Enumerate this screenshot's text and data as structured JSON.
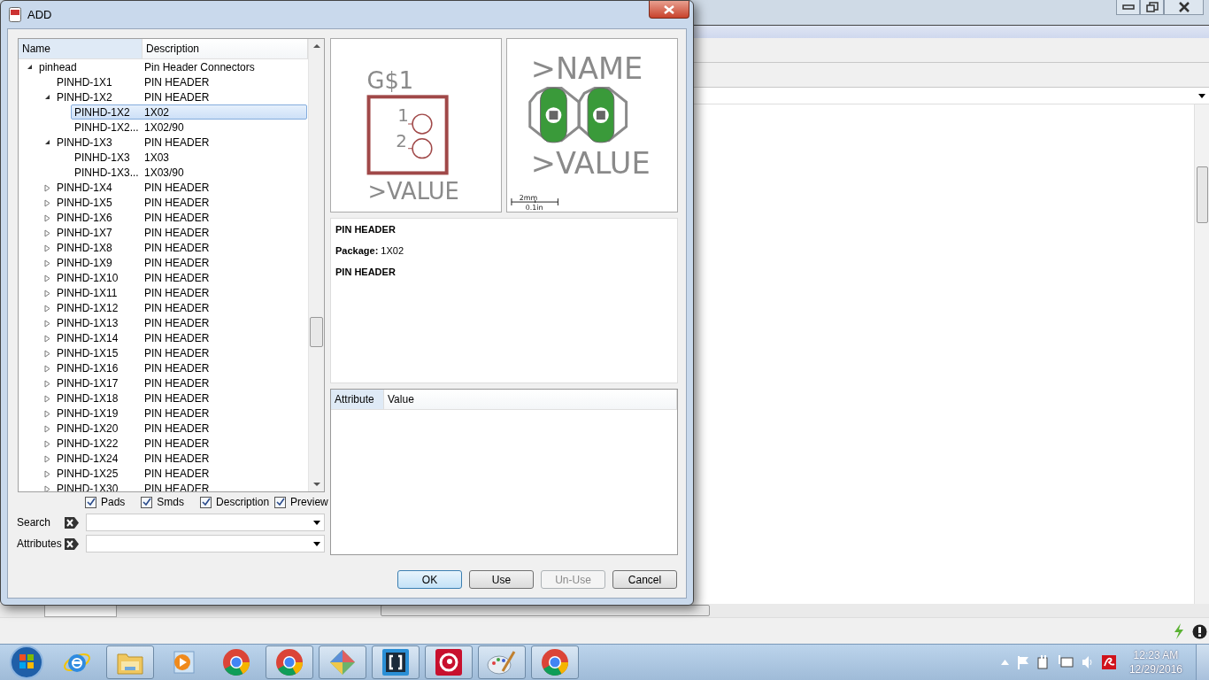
{
  "dialog": {
    "title": "ADD"
  },
  "tree": {
    "columns": [
      "Name",
      "Description"
    ],
    "items": [
      {
        "name": "pinhead",
        "description": "Pin Header Connectors",
        "expanded": true,
        "selected": false,
        "children": [
          {
            "name": "PINHD-1X1",
            "description": "PIN HEADER",
            "selected": false
          },
          {
            "name": "PINHD-1X2",
            "description": "PIN HEADER",
            "expanded": true,
            "selected": false,
            "children": [
              {
                "name": "PINHD-1X2",
                "description": "1X02",
                "selected": true
              },
              {
                "name": "PINHD-1X2...",
                "description": "1X02/90",
                "selected": false
              }
            ]
          },
          {
            "name": "PINHD-1X3",
            "description": "PIN HEADER",
            "expanded": true,
            "selected": false,
            "children": [
              {
                "name": "PINHD-1X3",
                "description": "1X03",
                "selected": false
              },
              {
                "name": "PINHD-1X3...",
                "description": "1X03/90",
                "selected": false
              }
            ]
          },
          {
            "name": "PINHD-1X4",
            "description": "PIN HEADER",
            "expanded": false,
            "selected": false
          },
          {
            "name": "PINHD-1X5",
            "description": "PIN HEADER",
            "expanded": false,
            "selected": false
          },
          {
            "name": "PINHD-1X6",
            "description": "PIN HEADER",
            "expanded": false,
            "selected": false
          },
          {
            "name": "PINHD-1X7",
            "description": "PIN HEADER",
            "expanded": false,
            "selected": false
          },
          {
            "name": "PINHD-1X8",
            "description": "PIN HEADER",
            "expanded": false,
            "selected": false
          },
          {
            "name": "PINHD-1X9",
            "description": "PIN HEADER",
            "expanded": false,
            "selected": false
          },
          {
            "name": "PINHD-1X10",
            "description": "PIN HEADER",
            "expanded": false,
            "selected": false
          },
          {
            "name": "PINHD-1X11",
            "description": "PIN HEADER",
            "expanded": false,
            "selected": false
          },
          {
            "name": "PINHD-1X12",
            "description": "PIN HEADER",
            "expanded": false,
            "selected": false
          },
          {
            "name": "PINHD-1X13",
            "description": "PIN HEADER",
            "expanded": false,
            "selected": false
          },
          {
            "name": "PINHD-1X14",
            "description": "PIN HEADER",
            "expanded": false,
            "selected": false
          },
          {
            "name": "PINHD-1X15",
            "description": "PIN HEADER",
            "expanded": false,
            "selected": false
          },
          {
            "name": "PINHD-1X16",
            "description": "PIN HEADER",
            "expanded": false,
            "selected": false
          },
          {
            "name": "PINHD-1X17",
            "description": "PIN HEADER",
            "expanded": false,
            "selected": false
          },
          {
            "name": "PINHD-1X18",
            "description": "PIN HEADER",
            "expanded": false,
            "selected": false
          },
          {
            "name": "PINHD-1X19",
            "description": "PIN HEADER",
            "expanded": false,
            "selected": false
          },
          {
            "name": "PINHD-1X20",
            "description": "PIN HEADER",
            "expanded": false,
            "selected": false
          },
          {
            "name": "PINHD-1X22",
            "description": "PIN HEADER",
            "expanded": false,
            "selected": false
          },
          {
            "name": "PINHD-1X24",
            "description": "PIN HEADER",
            "expanded": false,
            "selected": false
          },
          {
            "name": "PINHD-1X25",
            "description": "PIN HEADER",
            "expanded": false,
            "selected": false
          },
          {
            "name": "PINHD-1X30",
            "description": "PIN HEADER",
            "expanded": false,
            "selected": false
          }
        ]
      }
    ]
  },
  "options": [
    {
      "label": "Pads",
      "checked": true
    },
    {
      "label": "Smds",
      "checked": true
    },
    {
      "label": "Description",
      "checked": true
    },
    {
      "label": "Preview",
      "checked": true
    }
  ],
  "filters": [
    {
      "label": "Search"
    },
    {
      "label": "Attributes"
    }
  ],
  "symbol_preview": {
    "name": "G$1",
    "pins": [
      "1",
      "2"
    ],
    "value": ">VALUE"
  },
  "package_preview": {
    "name": ">NAME",
    "value": ">VALUE",
    "scale_metric": "2mm",
    "scale_imperial": "0.1in"
  },
  "description": {
    "title": "PIN HEADER",
    "package": "**Package:** 1X02",
    "text": "PIN HEADER"
  },
  "attributes_table": {
    "columns": [
      "Attribute",
      "Value"
    ]
  },
  "buttons": [
    {
      "label": "OK",
      "default": true,
      "disabled": false
    },
    {
      "label": "Use",
      "default": false,
      "disabled": false
    },
    {
      "label": "Un-Use",
      "default": false,
      "disabled": true
    },
    {
      "label": "Cancel",
      "default": false,
      "disabled": false
    }
  ],
  "taskbar": {
    "items": [
      {
        "kind": "ie",
        "active": false
      },
      {
        "kind": "folder",
        "active": true
      },
      {
        "kind": "media",
        "active": false
      },
      {
        "kind": "chrome",
        "active": false
      },
      {
        "kind": "chrome",
        "active": true
      },
      {
        "kind": "git",
        "active": true
      },
      {
        "kind": "brackets",
        "active": true
      },
      {
        "kind": "red",
        "active": true
      },
      {
        "kind": "paint",
        "active": true
      },
      {
        "kind": "chrome",
        "active": true
      }
    ],
    "time": "12:23 AM",
    "date": "12/29/2016"
  }
}
